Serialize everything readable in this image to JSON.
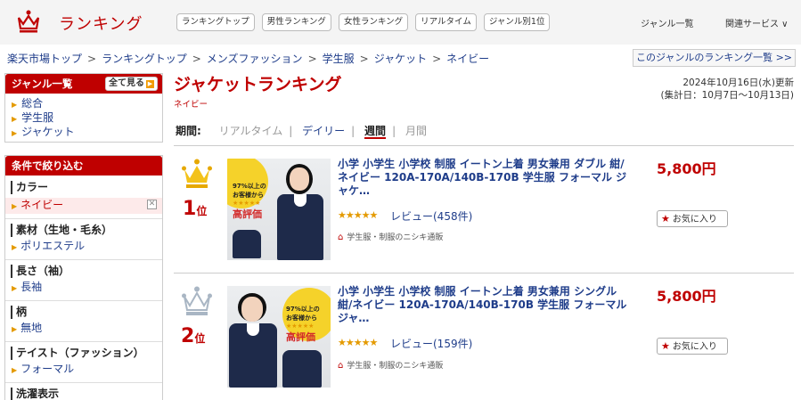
{
  "header": {
    "logo_text": "ランキング",
    "tabs": [
      "ランキングトップ",
      "男性ランキング",
      "女性ランキング",
      "リアルタイム",
      "ジャンル別1位"
    ],
    "genre_list": "ジャンル一覧",
    "related": "関連サービス ∨"
  },
  "breadcrumb": {
    "items": [
      "楽天市場トップ",
      "ランキングトップ",
      "メンズファッション",
      "学生服",
      "ジャケット",
      "ネイビー"
    ],
    "separator": ">",
    "genre_ranking_link": "このジャンルのランキング一覧 >>"
  },
  "sidebar": {
    "genre_title": "ジャンル一覧",
    "see_all": "全て見る",
    "genres": [
      "総合",
      "学生服",
      "ジャケット"
    ],
    "filter_title": "条件で絞り込む",
    "filters": [
      {
        "label": "カラー",
        "value": "ネイビー",
        "selected": true
      },
      {
        "label": "素材（生地・毛糸）",
        "value": "ポリエステル"
      },
      {
        "label": "長さ（袖）",
        "value": "長袖"
      },
      {
        "label": "柄",
        "value": "無地"
      },
      {
        "label": "テイスト（ファッション）",
        "value": "フォーマル"
      },
      {
        "label": "洗濯表示",
        "value": ""
      }
    ]
  },
  "main": {
    "title": "ジャケットランキング",
    "subtitle": "ネイビー",
    "updated": "2024年10月16日(水)更新",
    "period_range": "(集計日：10月7日〜10月13日)",
    "period_label": "期間:",
    "periods": [
      "リアルタイム",
      "デイリー",
      "週間",
      "月間"
    ],
    "current_period": "週間"
  },
  "items": [
    {
      "rank": "1",
      "rank_suffix": "位",
      "title": "小学 小学生 小学校 制服 イートン上着 男女兼用 ダブル 紺/ネイビー 120A-170A/140B-170B 学生服 フォーマル ジャケ…",
      "stars": "★★★★★",
      "review": "レビュー(458件)",
      "shop": "学生服・制服のニシキ通販",
      "price": "5,800円",
      "fav": "お気に入り",
      "badge_pct": "97%以上の",
      "badge_line2": "お客様から",
      "badge_main": "高評価"
    },
    {
      "rank": "2",
      "rank_suffix": "位",
      "title": "小学 小学生 小学校 制服 イートン上着 男女兼用 シングル 紺/ネイビー 120A-170A/140B-170B 学生服 フォーマル ジャ…",
      "stars": "★★★★★",
      "review": "レビュー(159件)",
      "shop": "学生服・制服のニシキ通販",
      "price": "5,800円",
      "fav": "お気に入り",
      "badge_pct": "97%以上の",
      "badge_line2": "お客様から",
      "badge_main": "高評価"
    }
  ],
  "colors": {
    "brand_red": "#bf0000",
    "link_blue": "#1f3d8a",
    "gold": "#e49a00",
    "silver": "#a9b6c4"
  },
  "icons": [
    "crown-logo-icon",
    "gold-crown-icon",
    "silver-crown-icon",
    "shop-home-icon",
    "favorite-star-icon",
    "clear-filter-icon"
  ]
}
